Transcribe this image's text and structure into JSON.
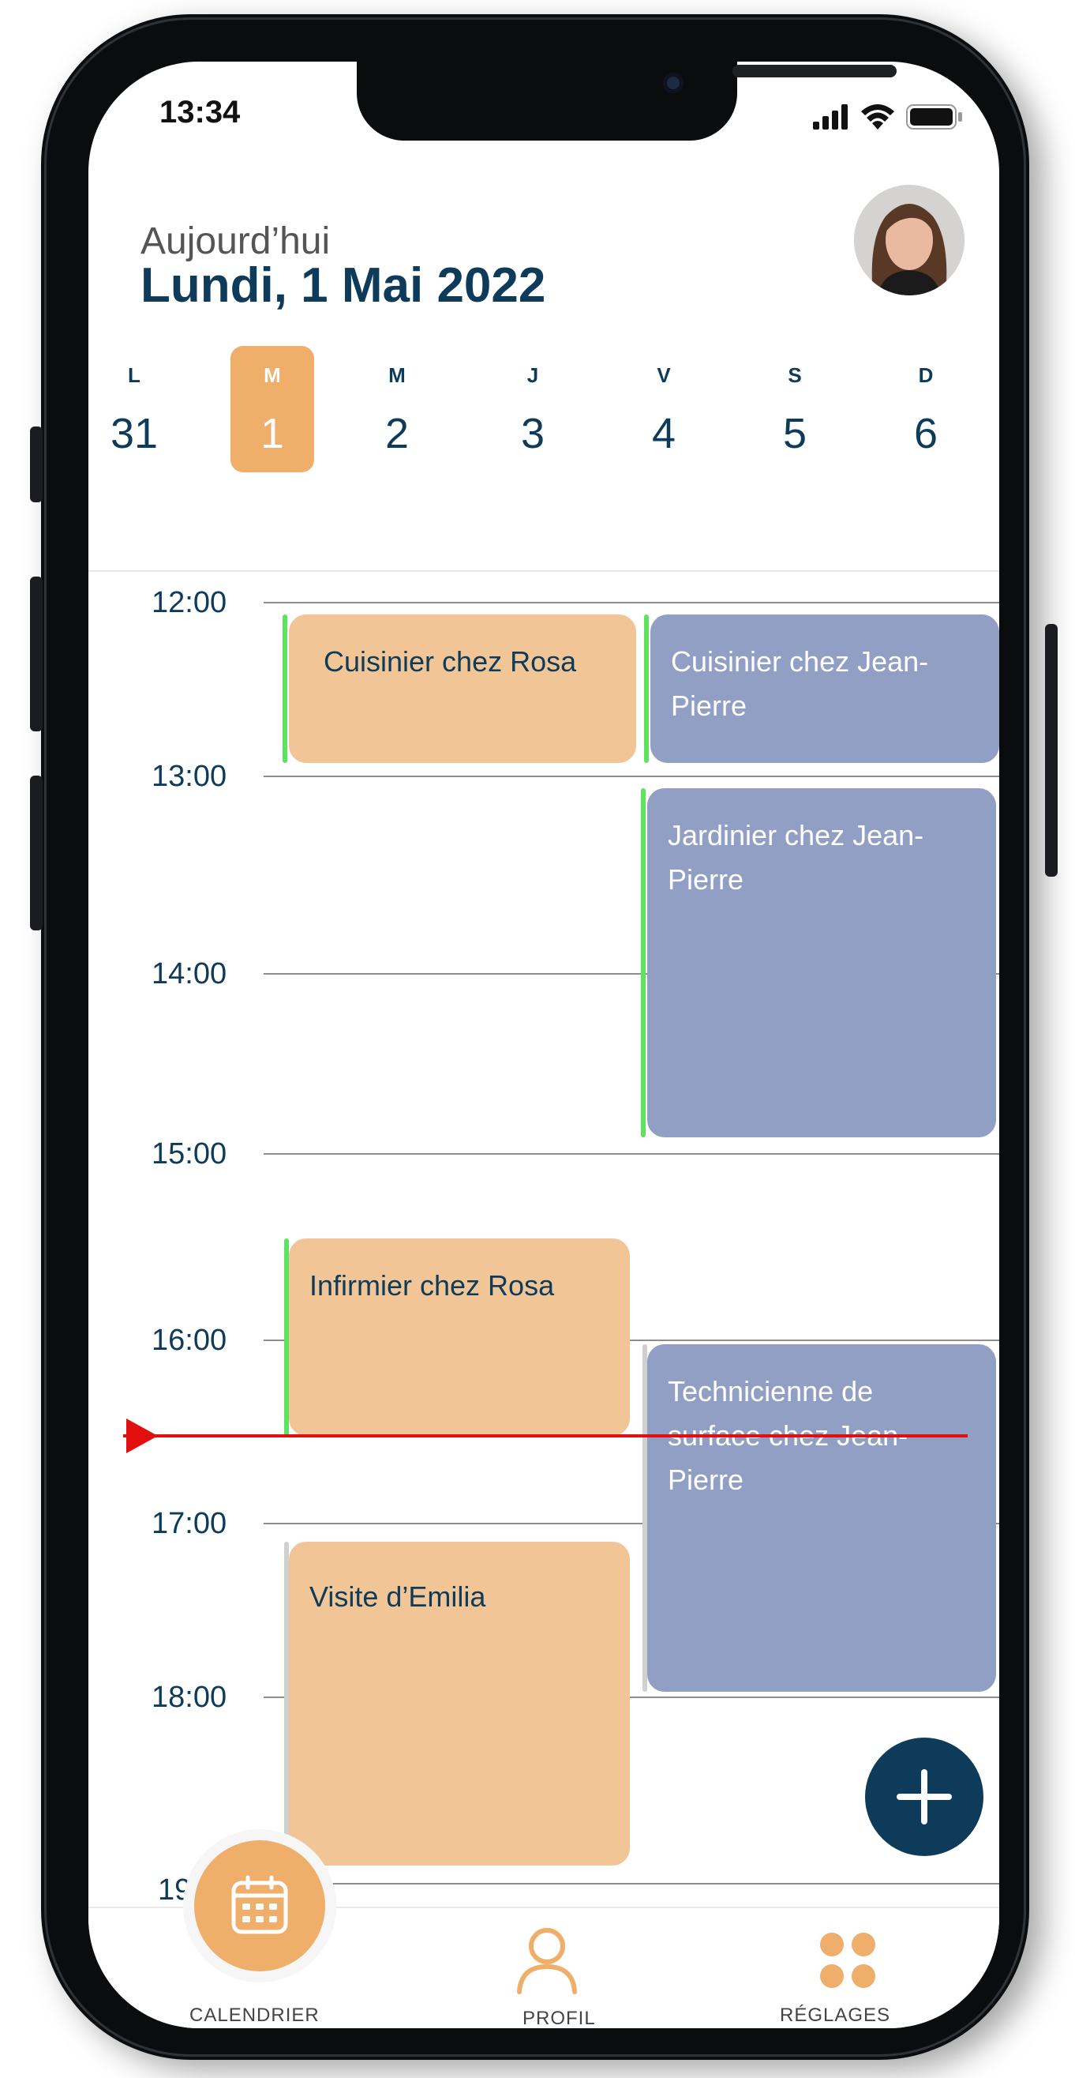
{
  "status_bar": {
    "time": "13:34"
  },
  "header": {
    "subtitle": "Aujourd’hui",
    "title": "Lundi, 1 Mai 2022"
  },
  "week": [
    {
      "letter": "L",
      "number": "31"
    },
    {
      "letter": "M",
      "number": "1"
    },
    {
      "letter": "M",
      "number": "2"
    },
    {
      "letter": "J",
      "number": "3"
    },
    {
      "letter": "V",
      "number": "4"
    },
    {
      "letter": "S",
      "number": "5"
    },
    {
      "letter": "D",
      "number": "6"
    }
  ],
  "hours": [
    "12:00",
    "13:00",
    "14:00",
    "15:00",
    "16:00",
    "17:00",
    "18:00",
    "19:"
  ],
  "events": [
    {
      "label": "Cuisinier chez Rosa",
      "color": "#f2c597"
    },
    {
      "label": "Cuisinier chez Jean-Pierre",
      "color": "#919fc5"
    },
    {
      "label": "Jardinier chez Jean-Pierre",
      "color": "#919fc5"
    },
    {
      "label": "Infirmier chez Rosa",
      "color": "#f2c597"
    },
    {
      "label": "Technicienne de surface chez Jean-Pierre",
      "color": "#919fc5"
    },
    {
      "label": "Visite d’Emilia",
      "color": "#f2c597"
    }
  ],
  "tabs": {
    "calendar": "CALENDRIER",
    "profile": "PROFIL",
    "settings": "RÉGLAGES"
  },
  "colors": {
    "accent": "#efae6a",
    "primary": "#0e3b5a",
    "event_blue": "#919fc5",
    "event_orange": "#f2c597",
    "now_line": "#e30f0f",
    "status_green": "#5fe35f"
  },
  "icons": [
    "calendar-icon",
    "person-icon",
    "grid-dots-icon",
    "plus-icon",
    "signal-icon",
    "wifi-icon",
    "battery-icon"
  ]
}
